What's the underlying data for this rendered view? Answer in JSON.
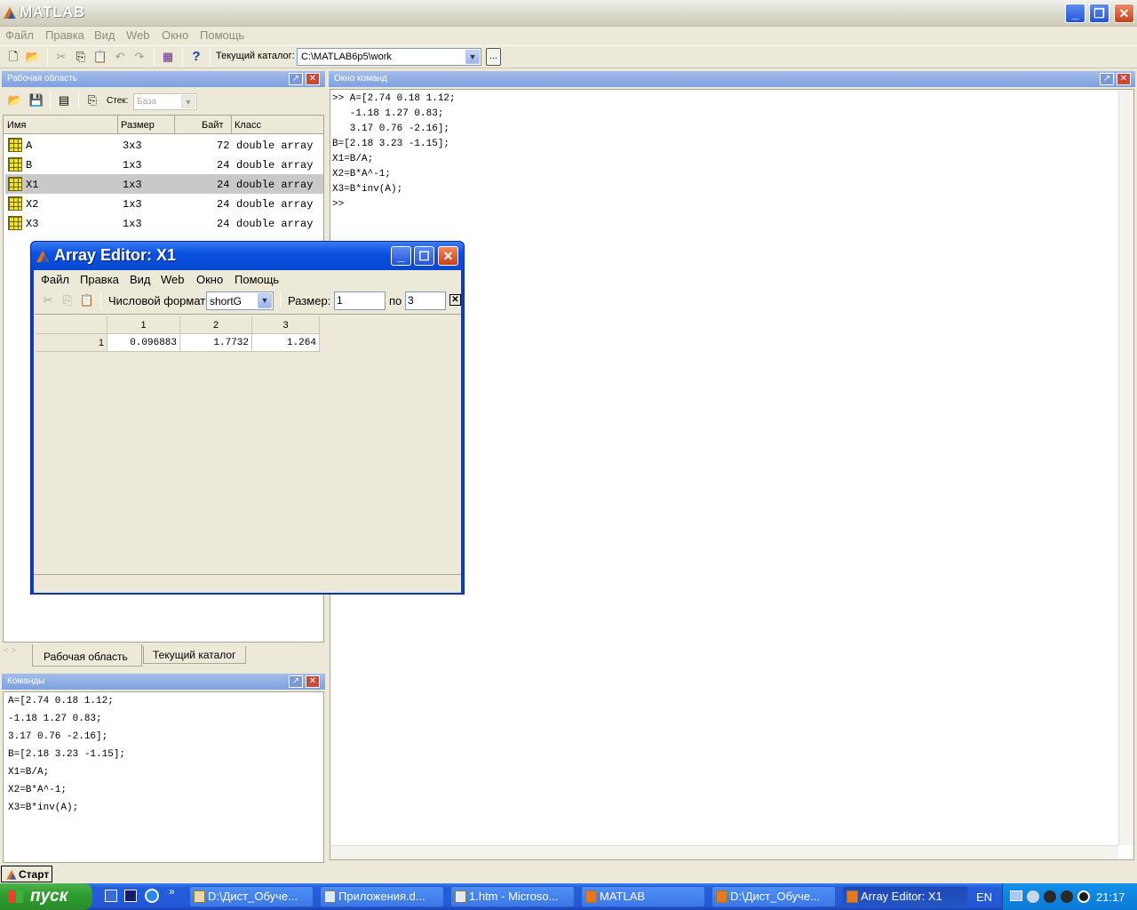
{
  "app": {
    "title": "MATLAB"
  },
  "menu": [
    "Файл",
    "Правка",
    "Вид",
    "Web",
    "Окно",
    "Помощь"
  ],
  "toolbar": {
    "catalog_label": "Текущий каталог:",
    "catalog_value": "C:\\MATLAB6p5\\work",
    "browse_label": "..."
  },
  "workspace": {
    "title": "Рабочая область",
    "stack_label": "Стек:",
    "stack_value": "База",
    "columns": [
      "Имя",
      "Размер",
      "Байт",
      "Класс"
    ],
    "rows": [
      {
        "name": "A",
        "size": "3x3",
        "bytes": "72",
        "class": "double array"
      },
      {
        "name": "B",
        "size": "1x3",
        "bytes": "24",
        "class": "double array"
      },
      {
        "name": "X1",
        "size": "1x3",
        "bytes": "24",
        "class": "double array"
      },
      {
        "name": "X2",
        "size": "1x3",
        "bytes": "24",
        "class": "double array"
      },
      {
        "name": "X3",
        "size": "1x3",
        "bytes": "24",
        "class": "double array"
      }
    ],
    "tabs": [
      "Рабочая область",
      "Текущий каталог"
    ]
  },
  "history": {
    "title": "Команды",
    "lines": [
      "A=[2.74 0.18 1.12;",
      "-1.18 1.27 0.83;",
      "3.17 0.76 -2.16];",
      "B=[2.18 3.23 -1.15];",
      "X1=B/A;",
      "X2=B*A^-1;",
      "X3=B*inv(A);"
    ]
  },
  "command_window": {
    "title": "Окно команд",
    "lines": [
      ">> A=[2.74 0.18 1.12;",
      "   -1.18 1.27 0.83;",
      "   3.17 0.76 -2.16];",
      "B=[2.18 3.23 -1.15];",
      "X1=B/A;",
      "X2=B*A^-1;",
      "X3=B*inv(A);",
      ">>"
    ]
  },
  "array_editor": {
    "title": "Array Editor: X1",
    "menu": [
      "Файл",
      "Правка",
      "Вид",
      "Web",
      "Окно",
      "Помощь"
    ],
    "format_label": "Числовой формат:",
    "format_value": "shortG",
    "size_label": "Размер:",
    "size_from": "1",
    "size_to_label": "по",
    "size_to": "3",
    "col_headers": [
      "1",
      "2",
      "3"
    ],
    "row_header": "1",
    "values": [
      "0.096883",
      "1.7732",
      "1.264"
    ]
  },
  "status_button": "Старт",
  "taskbar": {
    "start": "пуск",
    "tasks": [
      "D:\\Дист_Обуче...",
      "Приложения.d...",
      "1.htm - Microso...",
      "MATLAB",
      "D:\\Дист_Обуче...",
      "Array Editor: X1"
    ],
    "lang": "EN",
    "clock": "21:17"
  }
}
